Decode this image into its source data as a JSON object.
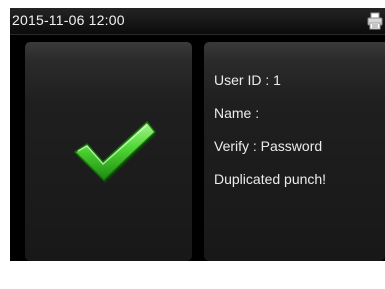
{
  "status_bar": {
    "datetime": "2015-11-06 12:00",
    "icon": "printer-icon"
  },
  "result": {
    "icon": "checkmark-icon",
    "icon_color": "#3fce2a"
  },
  "info": {
    "user_id": "User ID : 1",
    "name": "Name :",
    "verify": "Verify : Password",
    "message": "Duplicated punch!"
  }
}
